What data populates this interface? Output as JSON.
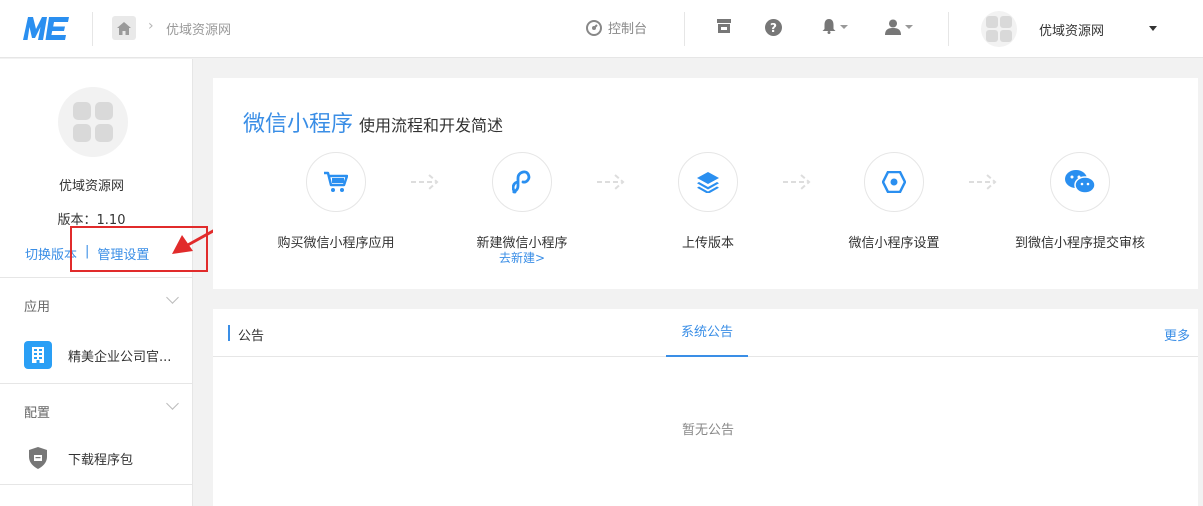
{
  "header": {
    "logo_text": "ME",
    "breadcrumb": "优域资源网",
    "console": "控制台",
    "user_name": "优域资源网"
  },
  "sidebar": {
    "name": "优域资源网",
    "version": "版本：1.10",
    "switch_version": "切换版本",
    "pipe": "|",
    "manage_settings": "管理设置",
    "sections": [
      {
        "title": "应用",
        "items": [
          {
            "label": "精美企业公司官...",
            "icon": "building-app-icon"
          }
        ]
      },
      {
        "title": "配置",
        "items": [
          {
            "label": "下载程序包",
            "icon": "shield-icon"
          }
        ]
      }
    ]
  },
  "main": {
    "title": "微信小程序",
    "subtitle": "使用流程和开发简述",
    "steps": [
      {
        "label": "购买微信小程序应用",
        "icon": "cart-icon"
      },
      {
        "label": "新建微信小程序",
        "link": "去新建>",
        "icon": "link-icon"
      },
      {
        "label": "上传版本",
        "icon": "layers-icon"
      },
      {
        "label": "微信小程序设置",
        "icon": "hexagon-icon"
      },
      {
        "label": "到微信小程序提交审核",
        "icon": "wechat-icon"
      }
    ],
    "notice": {
      "title": "公告",
      "tab": "系统公告",
      "more": "更多",
      "empty": "暂无公告"
    }
  },
  "colors": {
    "accent": "#3a8ee6",
    "annotation": "#e12b2b"
  }
}
